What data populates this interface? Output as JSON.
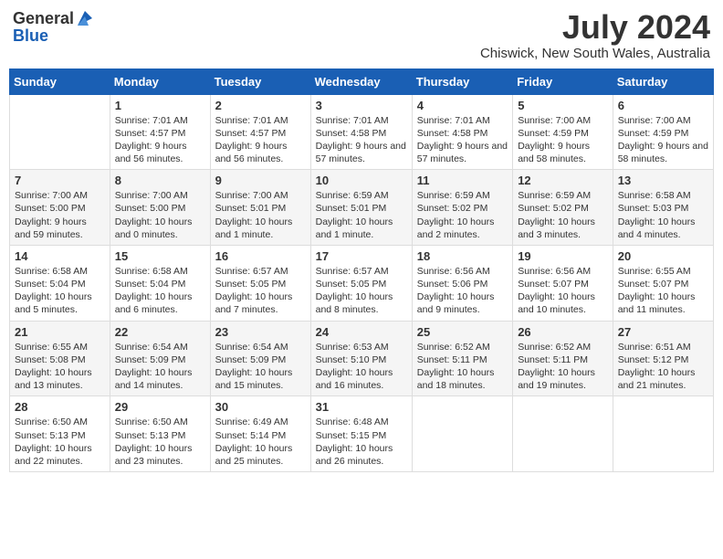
{
  "header": {
    "logo": {
      "line1": "General",
      "line2": "Blue"
    },
    "title": "July 2024",
    "location": "Chiswick, New South Wales, Australia"
  },
  "days": [
    "Sunday",
    "Monday",
    "Tuesday",
    "Wednesday",
    "Thursday",
    "Friday",
    "Saturday"
  ],
  "weeks": [
    [
      {
        "date": "",
        "sunrise": "",
        "sunset": "",
        "daylight": ""
      },
      {
        "date": "1",
        "sunrise": "Sunrise: 7:01 AM",
        "sunset": "Sunset: 4:57 PM",
        "daylight": "Daylight: 9 hours and 56 minutes."
      },
      {
        "date": "2",
        "sunrise": "Sunrise: 7:01 AM",
        "sunset": "Sunset: 4:57 PM",
        "daylight": "Daylight: 9 hours and 56 minutes."
      },
      {
        "date": "3",
        "sunrise": "Sunrise: 7:01 AM",
        "sunset": "Sunset: 4:58 PM",
        "daylight": "Daylight: 9 hours and 57 minutes."
      },
      {
        "date": "4",
        "sunrise": "Sunrise: 7:01 AM",
        "sunset": "Sunset: 4:58 PM",
        "daylight": "Daylight: 9 hours and 57 minutes."
      },
      {
        "date": "5",
        "sunrise": "Sunrise: 7:00 AM",
        "sunset": "Sunset: 4:59 PM",
        "daylight": "Daylight: 9 hours and 58 minutes."
      },
      {
        "date": "6",
        "sunrise": "Sunrise: 7:00 AM",
        "sunset": "Sunset: 4:59 PM",
        "daylight": "Daylight: 9 hours and 58 minutes."
      }
    ],
    [
      {
        "date": "7",
        "sunrise": "Sunrise: 7:00 AM",
        "sunset": "Sunset: 5:00 PM",
        "daylight": "Daylight: 9 hours and 59 minutes."
      },
      {
        "date": "8",
        "sunrise": "Sunrise: 7:00 AM",
        "sunset": "Sunset: 5:00 PM",
        "daylight": "Daylight: 10 hours and 0 minutes."
      },
      {
        "date": "9",
        "sunrise": "Sunrise: 7:00 AM",
        "sunset": "Sunset: 5:01 PM",
        "daylight": "Daylight: 10 hours and 1 minute."
      },
      {
        "date": "10",
        "sunrise": "Sunrise: 6:59 AM",
        "sunset": "Sunset: 5:01 PM",
        "daylight": "Daylight: 10 hours and 1 minute."
      },
      {
        "date": "11",
        "sunrise": "Sunrise: 6:59 AM",
        "sunset": "Sunset: 5:02 PM",
        "daylight": "Daylight: 10 hours and 2 minutes."
      },
      {
        "date": "12",
        "sunrise": "Sunrise: 6:59 AM",
        "sunset": "Sunset: 5:02 PM",
        "daylight": "Daylight: 10 hours and 3 minutes."
      },
      {
        "date": "13",
        "sunrise": "Sunrise: 6:58 AM",
        "sunset": "Sunset: 5:03 PM",
        "daylight": "Daylight: 10 hours and 4 minutes."
      }
    ],
    [
      {
        "date": "14",
        "sunrise": "Sunrise: 6:58 AM",
        "sunset": "Sunset: 5:04 PM",
        "daylight": "Daylight: 10 hours and 5 minutes."
      },
      {
        "date": "15",
        "sunrise": "Sunrise: 6:58 AM",
        "sunset": "Sunset: 5:04 PM",
        "daylight": "Daylight: 10 hours and 6 minutes."
      },
      {
        "date": "16",
        "sunrise": "Sunrise: 6:57 AM",
        "sunset": "Sunset: 5:05 PM",
        "daylight": "Daylight: 10 hours and 7 minutes."
      },
      {
        "date": "17",
        "sunrise": "Sunrise: 6:57 AM",
        "sunset": "Sunset: 5:05 PM",
        "daylight": "Daylight: 10 hours and 8 minutes."
      },
      {
        "date": "18",
        "sunrise": "Sunrise: 6:56 AM",
        "sunset": "Sunset: 5:06 PM",
        "daylight": "Daylight: 10 hours and 9 minutes."
      },
      {
        "date": "19",
        "sunrise": "Sunrise: 6:56 AM",
        "sunset": "Sunset: 5:07 PM",
        "daylight": "Daylight: 10 hours and 10 minutes."
      },
      {
        "date": "20",
        "sunrise": "Sunrise: 6:55 AM",
        "sunset": "Sunset: 5:07 PM",
        "daylight": "Daylight: 10 hours and 11 minutes."
      }
    ],
    [
      {
        "date": "21",
        "sunrise": "Sunrise: 6:55 AM",
        "sunset": "Sunset: 5:08 PM",
        "daylight": "Daylight: 10 hours and 13 minutes."
      },
      {
        "date": "22",
        "sunrise": "Sunrise: 6:54 AM",
        "sunset": "Sunset: 5:09 PM",
        "daylight": "Daylight: 10 hours and 14 minutes."
      },
      {
        "date": "23",
        "sunrise": "Sunrise: 6:54 AM",
        "sunset": "Sunset: 5:09 PM",
        "daylight": "Daylight: 10 hours and 15 minutes."
      },
      {
        "date": "24",
        "sunrise": "Sunrise: 6:53 AM",
        "sunset": "Sunset: 5:10 PM",
        "daylight": "Daylight: 10 hours and 16 minutes."
      },
      {
        "date": "25",
        "sunrise": "Sunrise: 6:52 AM",
        "sunset": "Sunset: 5:11 PM",
        "daylight": "Daylight: 10 hours and 18 minutes."
      },
      {
        "date": "26",
        "sunrise": "Sunrise: 6:52 AM",
        "sunset": "Sunset: 5:11 PM",
        "daylight": "Daylight: 10 hours and 19 minutes."
      },
      {
        "date": "27",
        "sunrise": "Sunrise: 6:51 AM",
        "sunset": "Sunset: 5:12 PM",
        "daylight": "Daylight: 10 hours and 21 minutes."
      }
    ],
    [
      {
        "date": "28",
        "sunrise": "Sunrise: 6:50 AM",
        "sunset": "Sunset: 5:13 PM",
        "daylight": "Daylight: 10 hours and 22 minutes."
      },
      {
        "date": "29",
        "sunrise": "Sunrise: 6:50 AM",
        "sunset": "Sunset: 5:13 PM",
        "daylight": "Daylight: 10 hours and 23 minutes."
      },
      {
        "date": "30",
        "sunrise": "Sunrise: 6:49 AM",
        "sunset": "Sunset: 5:14 PM",
        "daylight": "Daylight: 10 hours and 25 minutes."
      },
      {
        "date": "31",
        "sunrise": "Sunrise: 6:48 AM",
        "sunset": "Sunset: 5:15 PM",
        "daylight": "Daylight: 10 hours and 26 minutes."
      },
      {
        "date": "",
        "sunrise": "",
        "sunset": "",
        "daylight": ""
      },
      {
        "date": "",
        "sunrise": "",
        "sunset": "",
        "daylight": ""
      },
      {
        "date": "",
        "sunrise": "",
        "sunset": "",
        "daylight": ""
      }
    ]
  ]
}
